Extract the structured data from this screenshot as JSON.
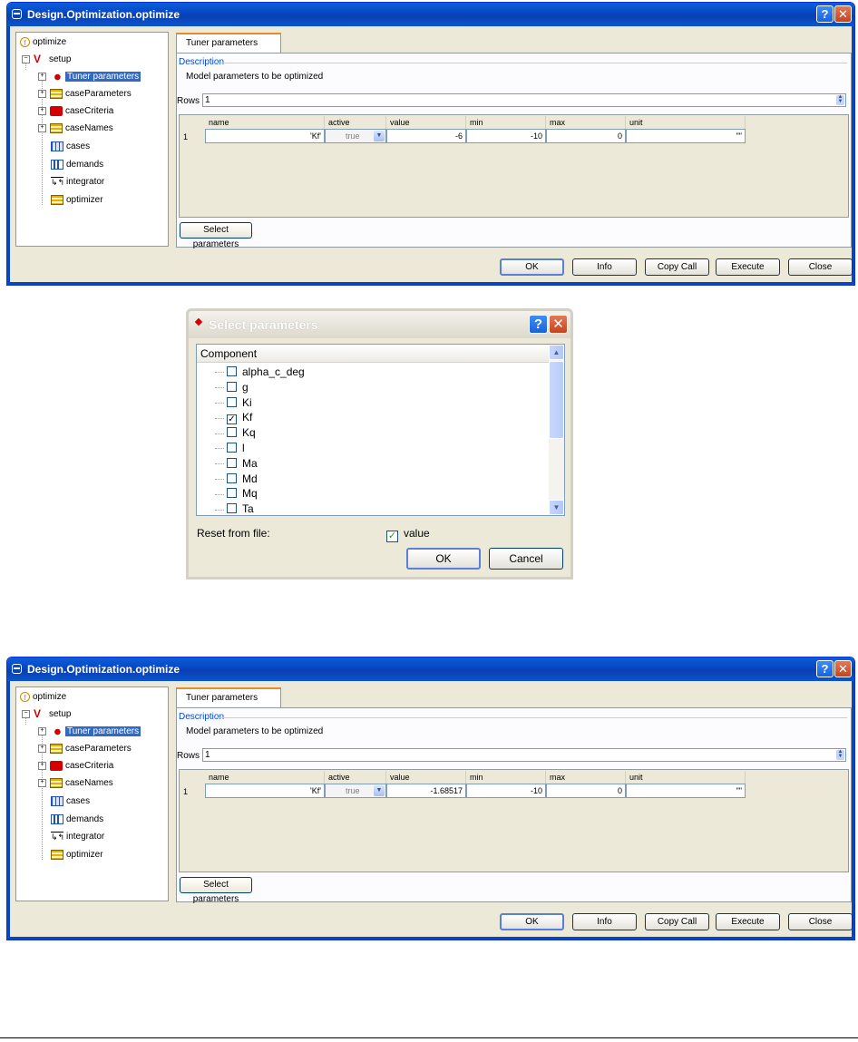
{
  "window_title": "Design.Optimization.optimize",
  "tree": [
    {
      "label": "optimize",
      "icon": "function-icon"
    },
    {
      "label": "setup",
      "icon": "v-icon"
    },
    {
      "label": "Tuner parameters",
      "icon": "tuner-icon",
      "selected": true
    },
    {
      "label": "caseParameters",
      "icon": "table-icon"
    },
    {
      "label": "caseCriteria",
      "icon": "criteria-icon"
    },
    {
      "label": "caseNames",
      "icon": "table-icon"
    },
    {
      "label": "cases",
      "icon": "grid-icon"
    },
    {
      "label": "demands",
      "icon": "bar-icon"
    },
    {
      "label": "integrator",
      "icon": "integrator-icon"
    },
    {
      "label": "optimizer",
      "icon": "table-icon"
    }
  ],
  "tab_label": "Tuner parameters",
  "description_legend": "Description",
  "description_text": "Model parameters to be optimized",
  "rows_label": "Rows",
  "rows_value": "1",
  "columns": [
    "name",
    "active",
    "value",
    "min",
    "max",
    "unit"
  ],
  "top_row": {
    "index": "1",
    "name": "'Kf'",
    "active": "true",
    "value": "-6",
    "min": "-10",
    "max": "0",
    "unit": "\"\""
  },
  "bottom_row": {
    "index": "1",
    "name": "'Kf'",
    "active": "true",
    "value": "-1.68517",
    "min": "-10",
    "max": "0",
    "unit": "\"\""
  },
  "select_params_label": "Select parameters",
  "buttons": {
    "ok": "OK",
    "info": "Info",
    "copy_call": "Copy Call",
    "execute": "Execute",
    "close": "Close"
  },
  "dialog": {
    "title": "Select parameters",
    "column_header": "Component",
    "items": [
      {
        "label": "alpha_c_deg",
        "checked": false
      },
      {
        "label": "g",
        "checked": false
      },
      {
        "label": "Ki",
        "checked": false
      },
      {
        "label": "Kf",
        "checked": true
      },
      {
        "label": "Kq",
        "checked": false
      },
      {
        "label": "l",
        "checked": false
      },
      {
        "label": "Ma",
        "checked": false
      },
      {
        "label": "Md",
        "checked": false
      },
      {
        "label": "Mq",
        "checked": false
      },
      {
        "label": "Ta",
        "checked": false
      }
    ],
    "reset_label": "Reset from file:",
    "value_label": "value",
    "value_checked": true,
    "ok": "OK",
    "cancel": "Cancel"
  },
  "colors": {
    "titlebar": "#0846c2",
    "selection": "#316ac5",
    "window_bg": "#ece9d8",
    "check": "#21a121"
  }
}
